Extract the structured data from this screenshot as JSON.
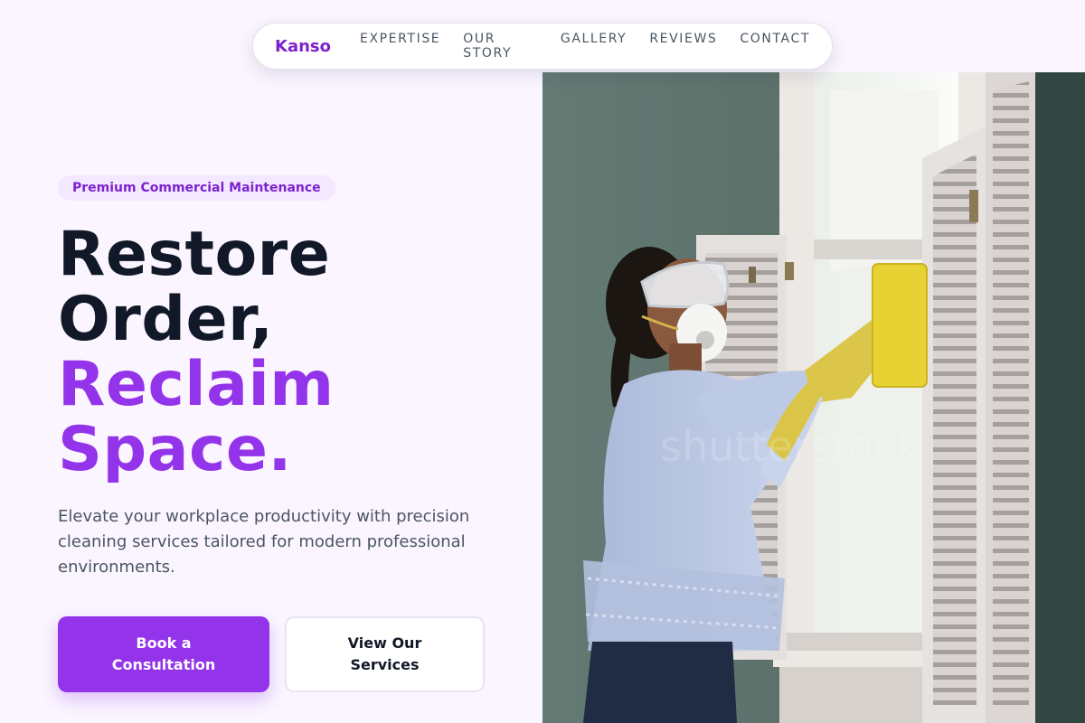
{
  "nav": {
    "brand": "Kanso",
    "links": [
      "EXPERTISE",
      "OUR STORY",
      "GALLERY",
      "REVIEWS",
      "CONTACT"
    ]
  },
  "hero": {
    "badge": "Premium Commercial Maintenance",
    "headline_line1": "Restore",
    "headline_line2": "Order,",
    "headline_line3": "Reclaim",
    "headline_line4": "Space.",
    "lede": "Elevate your workplace productivity with precision cleaning services tailored for modern professional environments.",
    "primary_cta": "Book a Consultation",
    "secondary_cta": "View Our Services",
    "image_alt": "Worker in protective goggles, mask and yellow gloves cleaning a window with a sponge beside white shutters",
    "watermark": "shutterstock"
  },
  "colors": {
    "accent": "#9333ea",
    "accent_dark": "#7e22ce",
    "badge_bg": "#f3e8ff",
    "page_bg": "#faf5ff",
    "heading": "#111827"
  }
}
